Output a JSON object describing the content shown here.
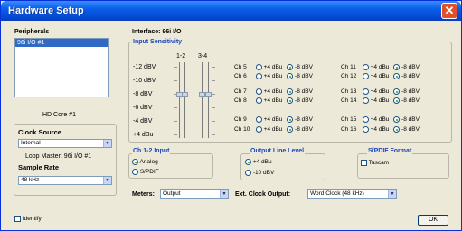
{
  "window": {
    "title": "Hardware Setup",
    "close_glyph": "✕"
  },
  "peripherals": {
    "heading": "Peripherals",
    "items": [
      "96i I/O #1"
    ],
    "core_label": "HD Core #1"
  },
  "interface_label": "Interface:  96i I/O",
  "clock": {
    "heading": "Clock Source",
    "value": "Internal",
    "loop_master": "Loop Master: 96i I/O #1",
    "rate_heading": "Sample Rate",
    "rate_value": "48 kHz"
  },
  "input_sensitivity": {
    "heading": "Input Sensitivity",
    "col1": "1-2",
    "col2": "3-4",
    "scale": [
      "-12 dBV",
      "-10 dBV",
      "-8 dBV",
      "-6 dBV",
      "-4 dBV",
      "+4 dBu"
    ],
    "opt_plus": "+4 dBu",
    "opt_minus": "-8 dBV",
    "channels": [
      {
        "name": "Ch 5",
        "selected": "minus"
      },
      {
        "name": "Ch 6",
        "selected": "minus"
      },
      {
        "name": "Ch 7",
        "selected": "minus"
      },
      {
        "name": "Ch 8",
        "selected": "minus"
      },
      {
        "name": "Ch 9",
        "selected": "minus"
      },
      {
        "name": "Ch 10",
        "selected": "minus"
      },
      {
        "name": "Ch 11",
        "selected": "minus"
      },
      {
        "name": "Ch 12",
        "selected": "minus"
      },
      {
        "name": "Ch 13",
        "selected": "minus"
      },
      {
        "name": "Ch 14",
        "selected": "minus"
      },
      {
        "name": "Ch 15",
        "selected": "minus"
      },
      {
        "name": "Ch 16",
        "selected": "minus"
      }
    ]
  },
  "ch12_input": {
    "heading": "Ch 1-2 Input",
    "options": [
      "Analog",
      "S/PDIF"
    ],
    "selected": 0
  },
  "output_level": {
    "heading": "Output Line Level",
    "options": [
      "+4 dBu",
      "-10 dBV"
    ],
    "selected": 0
  },
  "spdif": {
    "heading": "S/PDIF Format",
    "tascam_label": "Tascam"
  },
  "meters": {
    "label": "Meters:",
    "value": "Output"
  },
  "ext_clock": {
    "label": "Ext. Clock Output:",
    "value": "Word Clock (48 kHz)"
  },
  "identify_label": "Identify",
  "ok_label": "OK"
}
